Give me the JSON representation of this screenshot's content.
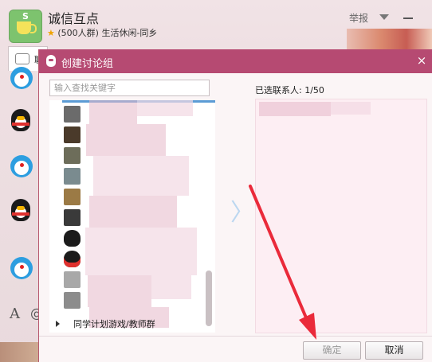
{
  "background_window": {
    "group_name": "诚信互点",
    "group_info": "(500人群) 生活休闲-同乡",
    "report_label": "举报",
    "chat_tab_label": "聊"
  },
  "dialog": {
    "title": "创建讨论组",
    "close_icon": "×",
    "search_placeholder": "输入查找关键字",
    "selected_label": "已选联系人: 1/50",
    "group_row_label": "同学计划游戏/教师群",
    "move_arrow_glyph": "〉",
    "ok_label": "确定",
    "cancel_label": "取消"
  },
  "colors": {
    "title_bar": "#b64a72",
    "selected_panel": "#fdeef3",
    "annotation_arrow": "#ea2a3a"
  }
}
